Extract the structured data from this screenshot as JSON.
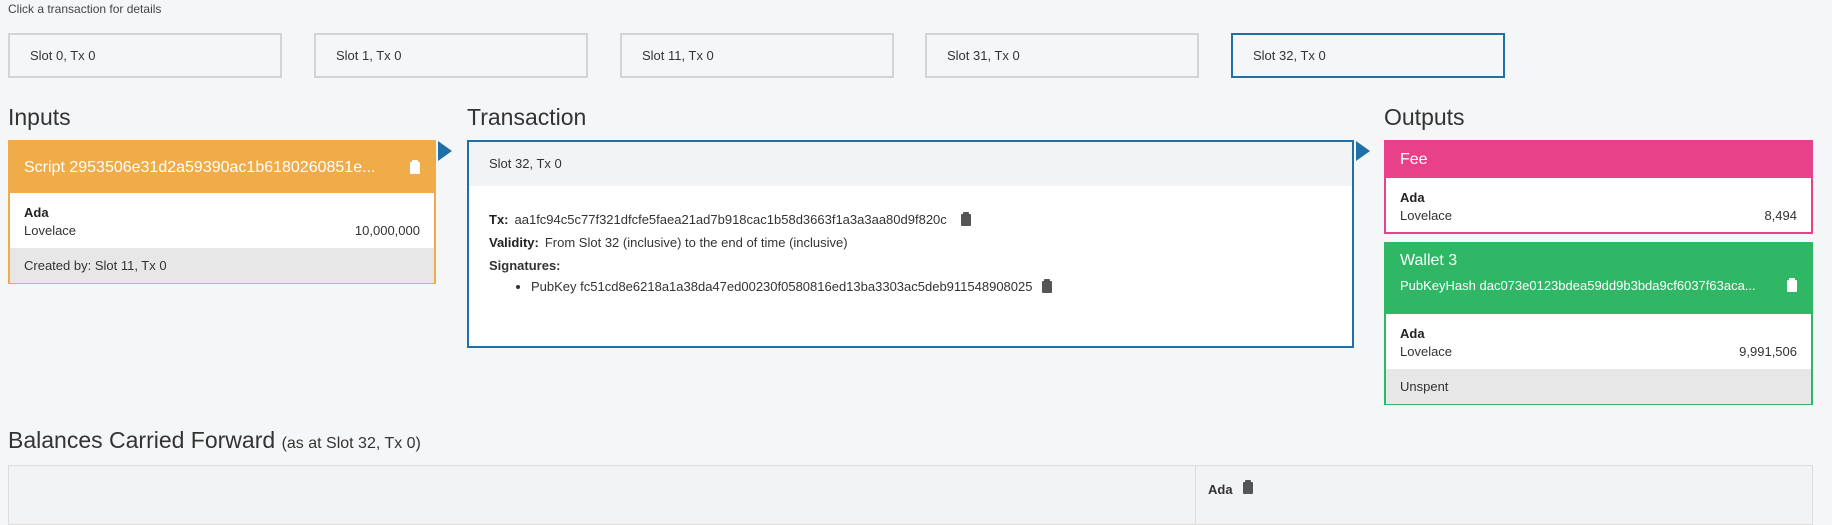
{
  "hint": "Click a transaction for details",
  "slots": [
    {
      "label": "Slot 0, Tx 0"
    },
    {
      "label": "Slot 1, Tx 0"
    },
    {
      "label": "Slot 11, Tx 0"
    },
    {
      "label": "Slot 31, Tx 0"
    },
    {
      "label": "Slot 32, Tx 0"
    }
  ],
  "colors": {
    "accent": "#1f6fa8",
    "input": "#f0ac48",
    "fee": "#e84189",
    "wallet": "#2fb765"
  },
  "inputs": {
    "title": "Inputs",
    "card": {
      "script": "Script 2953506e31d2a59390ac1b6180260851e...",
      "currency": "Ada",
      "token": "Lovelace",
      "amount": "10,000,000",
      "created_by": "Created by: Slot 11, Tx 0"
    }
  },
  "transaction": {
    "title": "Transaction",
    "slot": "Slot 32, Tx 0",
    "tx_label": "Tx:",
    "tx_id": "aa1fc94c5c77f321dfcfe5faea21ad7b918cac1b58d3663f1a3a3aa80d9f820c",
    "validity_label": "Validity:",
    "validity": "From Slot 32 (inclusive) to the end of time (inclusive)",
    "signatures_label": "Signatures:",
    "signatures": [
      "PubKey fc51cd8e6218a1a38da47ed00230f0580816ed13ba3303ac5deb911548908025"
    ]
  },
  "outputs": {
    "title": "Outputs",
    "fee": {
      "label": "Fee",
      "currency": "Ada",
      "token": "Lovelace",
      "amount": "8,494"
    },
    "wallet": {
      "name": "Wallet 3",
      "hash": "PubKeyHash dac073e0123bdea59dd9b3bda9cf6037f63aca...",
      "currency": "Ada",
      "token": "Lovelace",
      "amount": "9,991,506",
      "status": "Unspent"
    }
  },
  "balances": {
    "title": "Balances Carried Forward",
    "subtitle": "(as at Slot 32, Tx 0)",
    "column": "Ada"
  }
}
